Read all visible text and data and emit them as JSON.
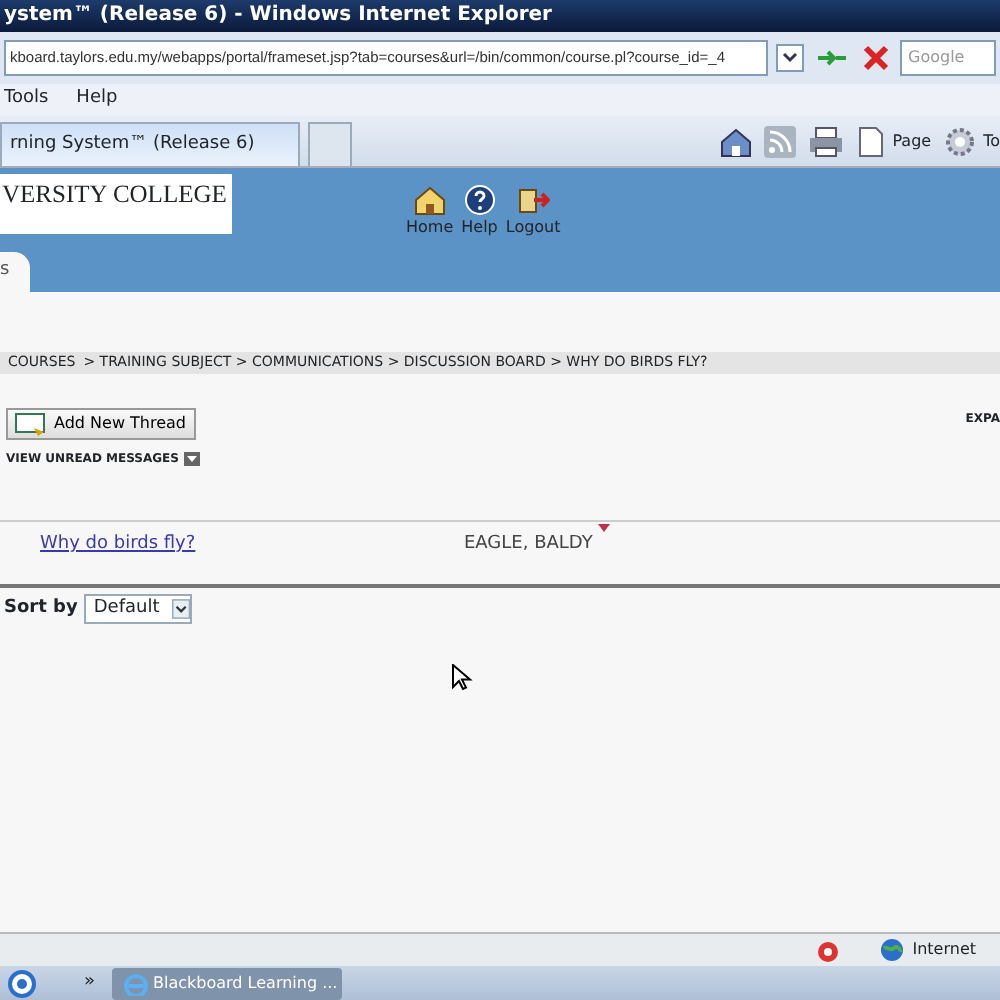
{
  "window": {
    "title": "ystem™ (Release 6) - Windows Internet Explorer"
  },
  "address_bar": {
    "url": "kboard.taylors.edu.my/webapps/portal/frameset.jsp?tab=courses&url=/bin/common/course.pl?course_id=_4",
    "search_placeholder": "Google"
  },
  "menu": [
    "Tools",
    "Help"
  ],
  "browser_tabs": [
    {
      "label": "rning System™ (Release 6)",
      "selected": true
    },
    {
      "selected": false
    }
  ],
  "command_bar": {
    "page": "Page",
    "tools": "To"
  },
  "header": {
    "logo": "VERSITY COLLEGE",
    "links": [
      {
        "kind": "home",
        "label": "Home"
      },
      {
        "kind": "help",
        "label": "Help"
      },
      {
        "kind": "logout",
        "label": "Logout"
      }
    ],
    "tab": "s"
  },
  "breadcrumb": {
    "link": "COURSES",
    "trail": "> TRAINING SUBJECT > COMMUNICATIONS > DISCUSSION BOARD > WHY DO BIRDS FLY?"
  },
  "add_button": "Add New Thread",
  "view_unread": "VIEW UNREAD MESSAGES",
  "expand": "EXPA",
  "threads": [
    {
      "subject": "Why do birds fly?",
      "author": "EAGLE, BALDY",
      "unread": true
    }
  ],
  "sort": {
    "label": "Sort by",
    "value": "Default"
  },
  "status_bar": {
    "zone": "Internet"
  },
  "taskbar": {
    "overflow": "»",
    "task": "Blackboard Learning ..."
  }
}
